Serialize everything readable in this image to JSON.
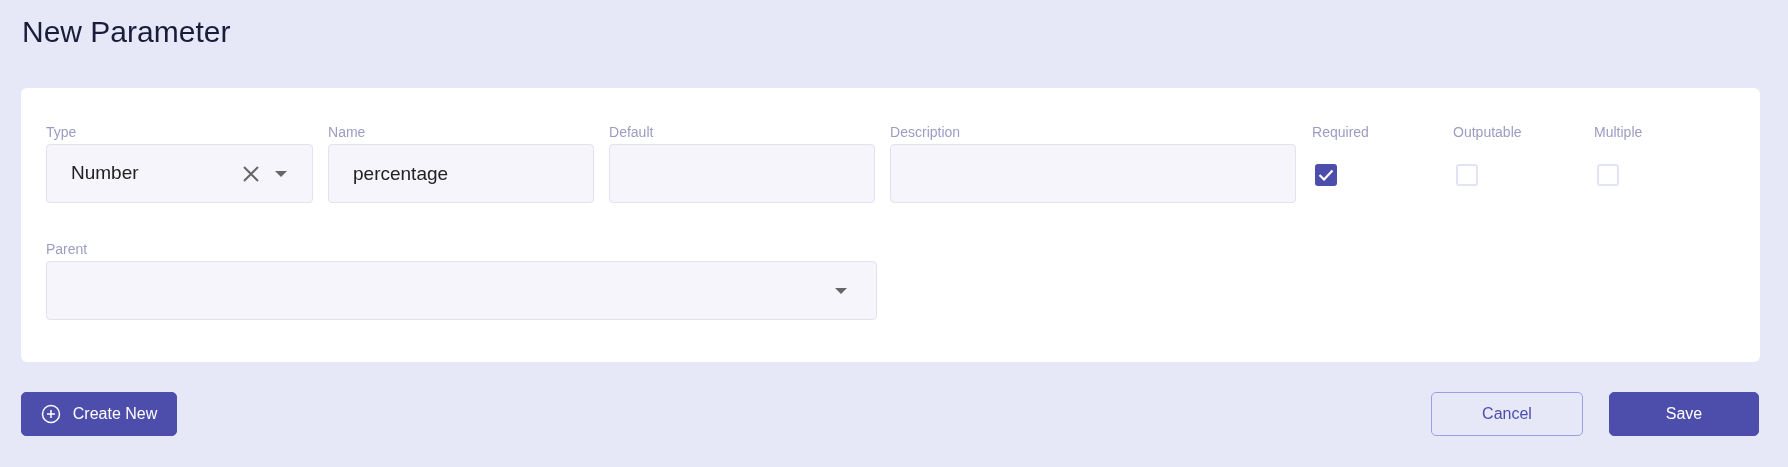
{
  "title": "New Parameter",
  "fields": [
    {
      "kind": "select",
      "label": "Type",
      "value": "Number",
      "clearable": true
    },
    {
      "kind": "text",
      "label": "Name",
      "value": "percentage"
    },
    {
      "kind": "text",
      "label": "Default"
    },
    {
      "kind": "text",
      "label": "Description"
    }
  ],
  "checkboxes": [
    {
      "label": "Required",
      "checked": true
    },
    {
      "label": "Outputable",
      "checked": false
    },
    {
      "label": "Multiple",
      "checked": false
    }
  ],
  "parent": {
    "label": "Parent"
  },
  "buttons": [
    {
      "kind": "create",
      "label": "Create New"
    },
    {
      "kind": "outline",
      "label": "Cancel"
    },
    {
      "kind": "primary",
      "label": "Save"
    }
  ]
}
